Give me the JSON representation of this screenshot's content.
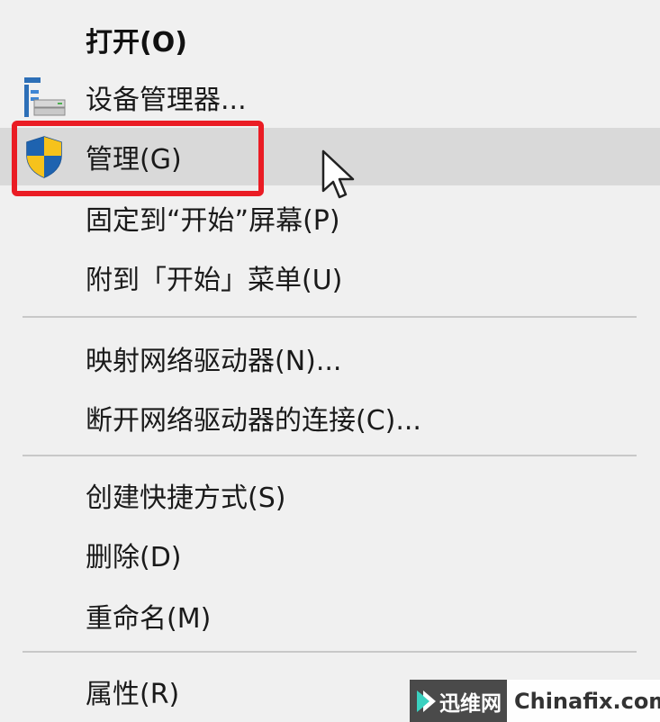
{
  "context_menu": {
    "items": [
      {
        "label": "打开(O)"
      },
      {
        "label": "设备管理器..."
      },
      {
        "label": "管理(G)"
      },
      {
        "label": "固定到“开始”屏幕(P)"
      },
      {
        "label": "附到「开始」菜单(U)"
      },
      {
        "label": "映射网络驱动器(N)..."
      },
      {
        "label": "断开网络驱动器的连接(C)..."
      },
      {
        "label": "创建快捷方式(S)"
      },
      {
        "label": "删除(D)"
      },
      {
        "label": "重命名(M)"
      },
      {
        "label": "属性(R)"
      }
    ],
    "hovered_item": "管理(G)",
    "icons": {
      "device_manager": "device-manager-icon",
      "manage": "uac-shield-icon"
    }
  },
  "annotation": {
    "highlight_color": "#ea1c24"
  },
  "watermark": {
    "brand": "迅维网",
    "site": "Chinafix.com"
  }
}
